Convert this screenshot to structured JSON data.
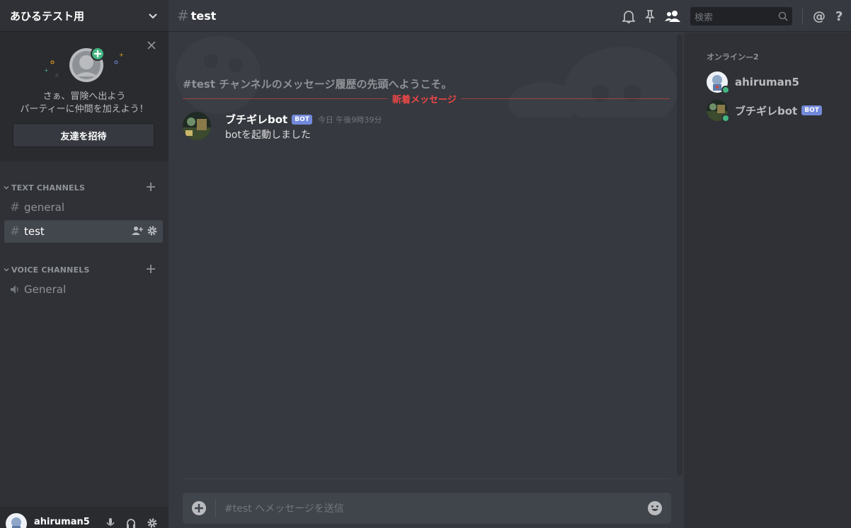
{
  "server": {
    "name": "あひるテスト用"
  },
  "invite": {
    "line1": "さぁ、冒険へ出よう",
    "line2": "パーティーに仲間を加えよう！",
    "button": "友達を招待"
  },
  "categories": {
    "text": "TEXT CHANNELS",
    "voice": "VOICE CHANNELS"
  },
  "channels": {
    "text": [
      {
        "name": "general",
        "active": false
      },
      {
        "name": "test",
        "active": true
      }
    ],
    "voice": [
      {
        "name": "General"
      }
    ]
  },
  "user": {
    "name": "ahiruman5"
  },
  "header": {
    "channel": "test",
    "search_placeholder": "検索"
  },
  "chat": {
    "welcome": "#test チャンネルのメッセージ履歴の先頭へようこそ。",
    "new_messages": "新着メッセージ",
    "messages": [
      {
        "author": "ブチギレbot",
        "tag": "BOT",
        "time": "今日 午後9時39分",
        "text": "botを起動しました"
      }
    ]
  },
  "composer": {
    "placeholder": "#test へメッセージを送信"
  },
  "members": {
    "heading": "オンライン—2",
    "list": [
      {
        "name": "ahiruman5",
        "status": "online"
      },
      {
        "name": "ブチギレbot",
        "tag": "BOT",
        "status": "online"
      }
    ]
  },
  "colors": {
    "accent": "#7289da",
    "online": "#43b581",
    "new_messages": "#f04747"
  }
}
